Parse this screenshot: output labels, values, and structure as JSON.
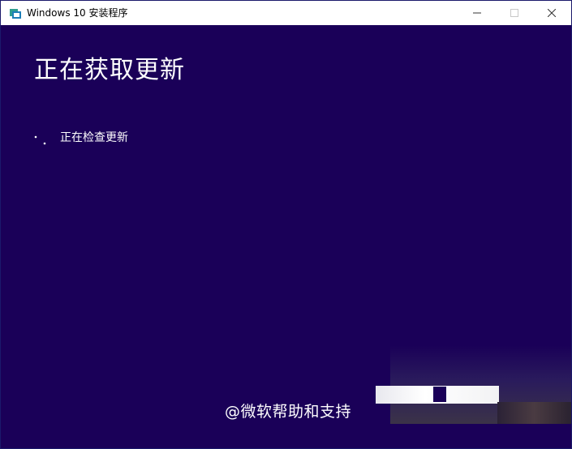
{
  "window": {
    "title": "Windows 10 安装程序",
    "icon": "setup-app-icon",
    "controls": {
      "minimize": "minimize-icon",
      "maximize": "maximize-icon",
      "close": "close-icon"
    }
  },
  "main": {
    "heading": "正在获取更新",
    "status_text": "正在检查更新"
  },
  "overlay": {
    "watermark": "@微软帮助和支持"
  },
  "colors": {
    "background": "#1a0058",
    "titlebar": "#ffffff",
    "text": "#ffffff"
  }
}
